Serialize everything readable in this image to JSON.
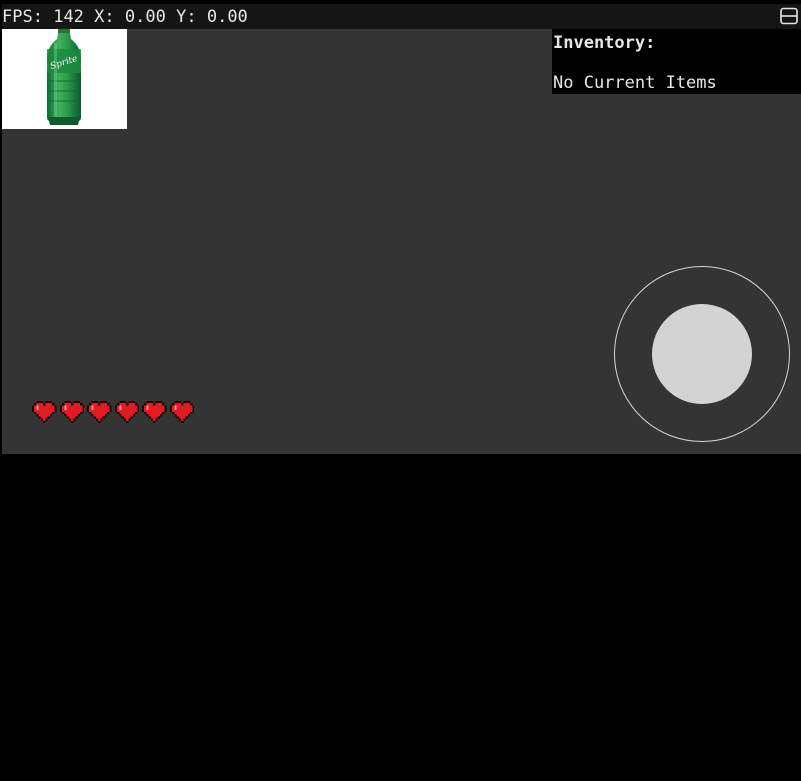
{
  "hud": {
    "fps_label": "FPS:",
    "fps_value": "142",
    "x_label": "X:",
    "x_value": "0.00",
    "y_label": "Y:",
    "y_value": "0.00"
  },
  "fullscreen_icon": "fullscreen-icon",
  "item_slot": {
    "item_icon": "soda-bottle-icon",
    "item_brand": "Sprite"
  },
  "inventory": {
    "title": "Inventory:",
    "empty_message": "No Current Items"
  },
  "health": {
    "hearts": 6,
    "max_hearts": 6,
    "heart_icon": "heart-icon",
    "heart_color": "#e01b24"
  },
  "joystick": {
    "icon": "virtual-joystick"
  },
  "colors": {
    "game_background": "#343434",
    "hud_background": "#151515",
    "page_background": "#000000"
  }
}
